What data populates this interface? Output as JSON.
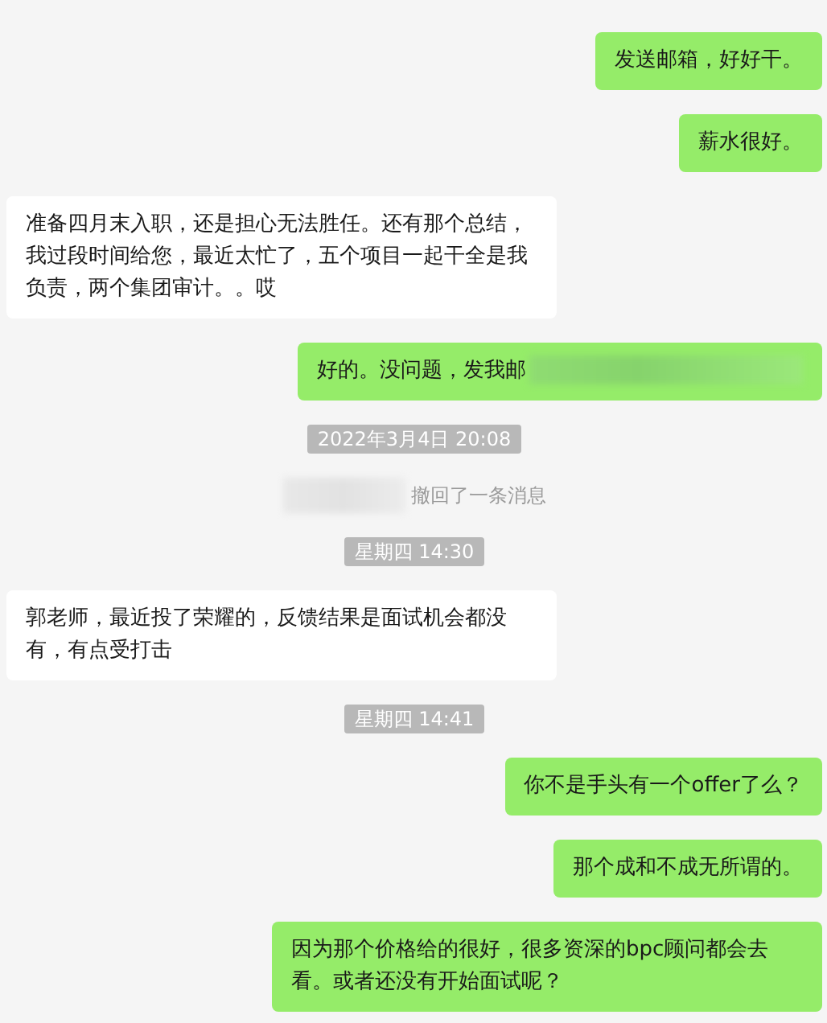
{
  "messages": [
    {
      "kind": "sent",
      "text": "发送邮箱，好好干。"
    },
    {
      "kind": "sent",
      "text": "薪水很好。"
    },
    {
      "kind": "received",
      "text": "准备四月末入职，还是担心无法胜任。还有那个总结，我过段时间给您，最近太忙了，五个项目一起干全是我负责，两个集团审计。。哎"
    },
    {
      "kind": "sent",
      "text": "好的。没问题，发我邮",
      "redacted": true
    },
    {
      "kind": "time",
      "text": "2022年3月4日 20:08"
    },
    {
      "kind": "recall",
      "text": "撤回了一条消息"
    },
    {
      "kind": "time",
      "text": "星期四 14:30"
    },
    {
      "kind": "received",
      "text": "郭老师，最近投了荣耀的，反馈结果是面试机会都没有，有点受打击"
    },
    {
      "kind": "time",
      "text": "星期四 14:41"
    },
    {
      "kind": "sent",
      "text": "你不是手头有一个offer了么？"
    },
    {
      "kind": "sent",
      "text": "那个成和不成无所谓的。"
    },
    {
      "kind": "sent",
      "text": "因为那个价格给的很好，很多资深的bpc顾问都会去看。或者还没有开始面试呢？"
    }
  ]
}
